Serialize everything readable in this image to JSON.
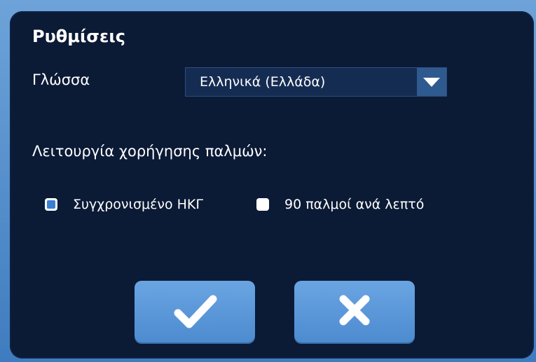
{
  "dialog": {
    "title": "Ρυθμίσεις",
    "language": {
      "label": "Γλώσσα",
      "selected": "Ελληνικά (Ελλάδα)",
      "dropdown_icon": "triangle-down-icon"
    },
    "pulse_mode": {
      "label": "Λειτουργία χορήγησης παλμών:",
      "options": [
        {
          "label": "Συγχρονισμένο ΗΚΓ",
          "checked": true
        },
        {
          "label": "90 παλμοί ανά λεπτό",
          "checked": false
        }
      ]
    },
    "buttons": {
      "confirm_icon": "checkmark-icon",
      "cancel_icon": "close-x-icon"
    }
  },
  "colors": {
    "dialog_bg": "#0b1a35",
    "button_bg": "#5a98da",
    "checkbox_accent": "#3b7fd0"
  }
}
